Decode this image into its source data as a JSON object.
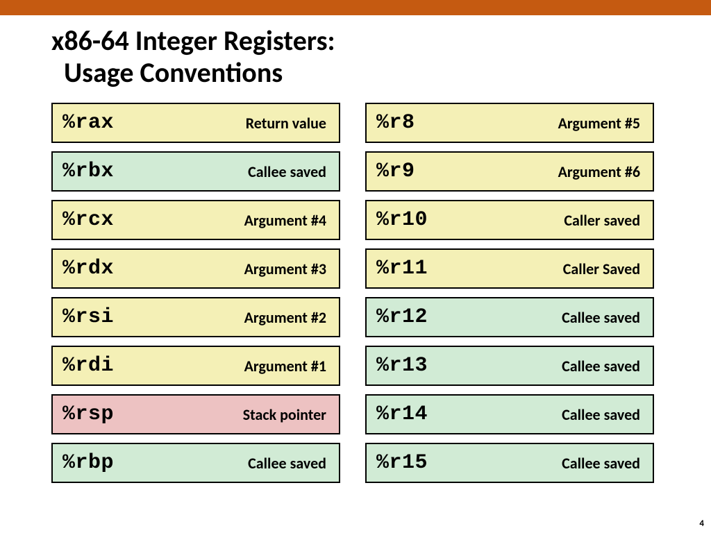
{
  "title_line1": "x86-64 Integer Registers:",
  "title_line2": "Usage Conventions",
  "page_number": "4",
  "left": [
    {
      "name": "%rax",
      "desc": "Return value",
      "color": "yellow"
    },
    {
      "name": "%rbx",
      "desc": "Callee saved",
      "color": "green"
    },
    {
      "name": "%rcx",
      "desc": "Argument #4",
      "color": "yellow"
    },
    {
      "name": "%rdx",
      "desc": "Argument #3",
      "color": "yellow"
    },
    {
      "name": "%rsi",
      "desc": "Argument #2",
      "color": "yellow"
    },
    {
      "name": "%rdi",
      "desc": "Argument #1",
      "color": "yellow"
    },
    {
      "name": "%rsp",
      "desc": "Stack pointer",
      "color": "pink"
    },
    {
      "name": "%rbp",
      "desc": "Callee saved",
      "color": "green"
    }
  ],
  "right": [
    {
      "name": "%r8",
      "desc": "Argument #5",
      "color": "yellow"
    },
    {
      "name": "%r9",
      "desc": "Argument #6",
      "color": "yellow"
    },
    {
      "name": "%r10",
      "desc": "Caller saved",
      "color": "yellow"
    },
    {
      "name": "%r11",
      "desc": "Caller Saved",
      "color": "yellow"
    },
    {
      "name": "%r12",
      "desc": "Callee saved",
      "color": "green"
    },
    {
      "name": "%r13",
      "desc": "Callee saved",
      "color": "green"
    },
    {
      "name": "%r14",
      "desc": "Callee saved",
      "color": "green"
    },
    {
      "name": "%r15",
      "desc": "Callee saved",
      "color": "green"
    }
  ]
}
